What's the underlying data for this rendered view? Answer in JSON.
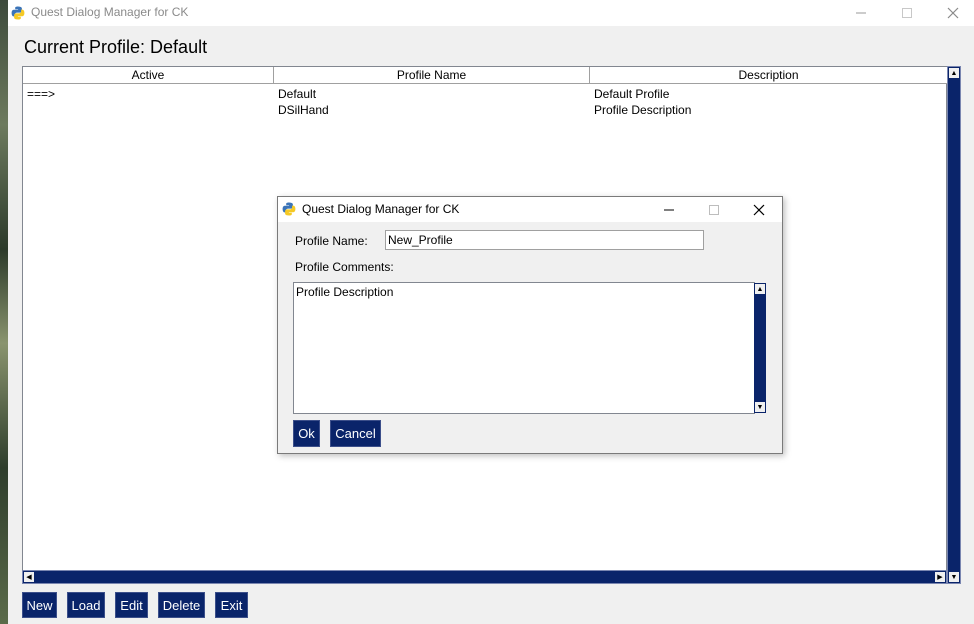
{
  "window": {
    "title": "Quest Dialog Manager for CK",
    "minimize_icon": "minimize-icon",
    "maximize_icon": "maximize-icon",
    "close_icon": "close-icon"
  },
  "header": {
    "current_profile": "Current Profile: Default"
  },
  "table": {
    "columns": [
      "Active",
      "Profile Name",
      "Description"
    ],
    "rows": [
      {
        "active": "===>",
        "name": "Default",
        "description": "Default Profile"
      },
      {
        "active": "",
        "name": "DSilHand",
        "description": "Profile Description"
      }
    ]
  },
  "buttons": {
    "new": "New",
    "load": "Load",
    "edit": "Edit",
    "delete": "Delete",
    "exit": "Exit"
  },
  "dialog": {
    "title": "Quest Dialog Manager for CK",
    "profile_name_label": "Profile Name:",
    "profile_name_value": "New_Profile",
    "profile_comments_label": "Profile Comments:",
    "profile_comments_value": "Profile Description",
    "ok": "Ok",
    "cancel": "Cancel"
  },
  "colors": {
    "button_bg": "#0a246a",
    "button_text": "#ffffff",
    "scrollbar": "#0a246a"
  }
}
